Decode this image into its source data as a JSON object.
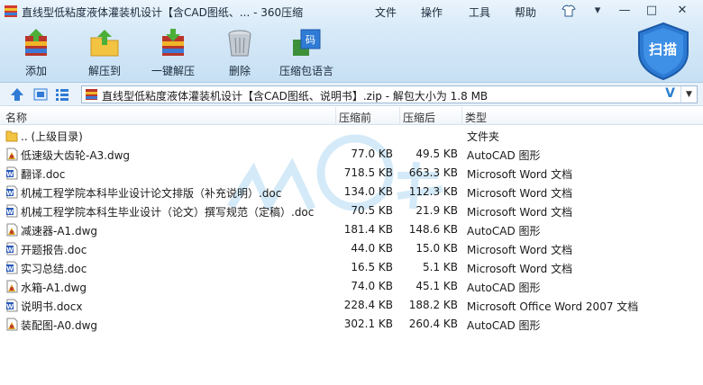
{
  "window": {
    "title": "直线型低粘度液体灌装机设计【含CAD图纸、... - 360压缩",
    "menus": [
      "文件",
      "操作",
      "工具",
      "帮助"
    ]
  },
  "toolbar": {
    "add": "添加",
    "extract_to": "解压到",
    "one_click_extract": "一键解压",
    "delete": "删除",
    "archive_language": "压缩包语言",
    "scan": "扫描"
  },
  "address": {
    "text": "直线型低粘度液体灌装机设计【含CAD图纸、说明书】.zip - 解包大小为 1.8 MB"
  },
  "columns": {
    "name": "名称",
    "compressed": "压缩前",
    "original": "压缩后",
    "type": "类型"
  },
  "files": [
    {
      "name": ".. (上级目录)",
      "csize": "",
      "osize": "",
      "type": "文件夹",
      "icon": "folder-icon"
    },
    {
      "name": "低速级大齿轮-A3.dwg",
      "csize": "77.0 KB",
      "osize": "49.5 KB",
      "type": "AutoCAD 图形",
      "icon": "dwg-file-icon"
    },
    {
      "name": "翻译.doc",
      "csize": "718.5 KB",
      "osize": "663.3 KB",
      "type": "Microsoft Word 文档",
      "icon": "word-file-icon"
    },
    {
      "name": "机械工程学院本科毕业设计论文排版（补充说明）.doc",
      "csize": "134.0 KB",
      "osize": "112.3 KB",
      "type": "Microsoft Word 文档",
      "icon": "word-file-icon"
    },
    {
      "name": "机械工程学院本科生毕业设计（论文）撰写规范（定稿）.doc",
      "csize": "70.5 KB",
      "osize": "21.9 KB",
      "type": "Microsoft Word 文档",
      "icon": "word-file-icon"
    },
    {
      "name": "减速器-A1.dwg",
      "csize": "181.4 KB",
      "osize": "148.6 KB",
      "type": "AutoCAD 图形",
      "icon": "dwg-file-icon"
    },
    {
      "name": "开题报告.doc",
      "csize": "44.0 KB",
      "osize": "15.0 KB",
      "type": "Microsoft Word 文档",
      "icon": "word-file-icon"
    },
    {
      "name": "实习总结.doc",
      "csize": "16.5 KB",
      "osize": "5.1 KB",
      "type": "Microsoft Word 文档",
      "icon": "word-file-icon"
    },
    {
      "name": "水箱-A1.dwg",
      "csize": "74.0 KB",
      "osize": "45.1 KB",
      "type": "AutoCAD 图形",
      "icon": "dwg-file-icon"
    },
    {
      "name": "说明书.docx",
      "csize": "228.4 KB",
      "osize": "188.2 KB",
      "type": "Microsoft Office Word 2007 文档",
      "icon": "word-file-icon"
    },
    {
      "name": "装配图-A0.dwg",
      "csize": "302.1 KB",
      "osize": "260.4 KB",
      "type": "AutoCAD 图形",
      "icon": "dwg-file-icon"
    }
  ],
  "colors": {
    "accent": "#2a7fd0",
    "chrome": "#d6e9f8"
  }
}
